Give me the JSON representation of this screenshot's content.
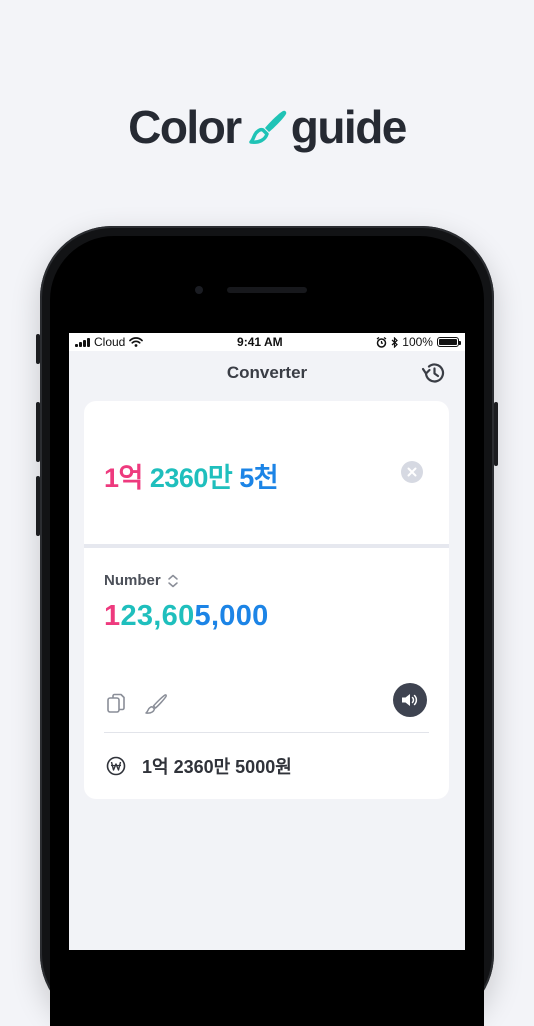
{
  "brand": {
    "left_text": "Color",
    "right_text": "guide",
    "logo_icon": "paintbrush-icon",
    "colors": {
      "text": "#262a33",
      "accent": "#1fc3b6"
    }
  },
  "status_bar": {
    "carrier": "Cloud",
    "time": "9:41 AM",
    "battery": "100%",
    "icons": [
      "signal-icon",
      "wifi-icon",
      "alarm-icon",
      "bluetooth-icon",
      "battery-icon"
    ]
  },
  "nav": {
    "title": "Converter",
    "history_icon": "history-icon"
  },
  "input": {
    "segments": [
      {
        "text": "1억",
        "color": "#ee3a7e"
      },
      {
        "text": " 2360만",
        "color": "#1fbfbd"
      },
      {
        "text": " 5천",
        "color": "#1c84e6"
      }
    ],
    "clear_icon": "clear-icon"
  },
  "result": {
    "unit_label": "Number",
    "unit_selector_icon": "chevron-up-down-icon",
    "number_segments": [
      {
        "text": "1",
        "color": "#ee3a7e"
      },
      {
        "text": "23,60",
        "color": "#1fbfbd"
      },
      {
        "text": "5,000",
        "color": "#1c84e6"
      }
    ],
    "actions": [
      "copy-icon",
      "paintbrush-icon",
      "speaker-icon"
    ],
    "won_text": "1억 2360만 5000원",
    "won_icon": "won-icon"
  },
  "colors": {
    "pink": "#ee3a7e",
    "teal": "#1fbfbd",
    "blue": "#1c84e6",
    "background": "#f2f3f7"
  }
}
